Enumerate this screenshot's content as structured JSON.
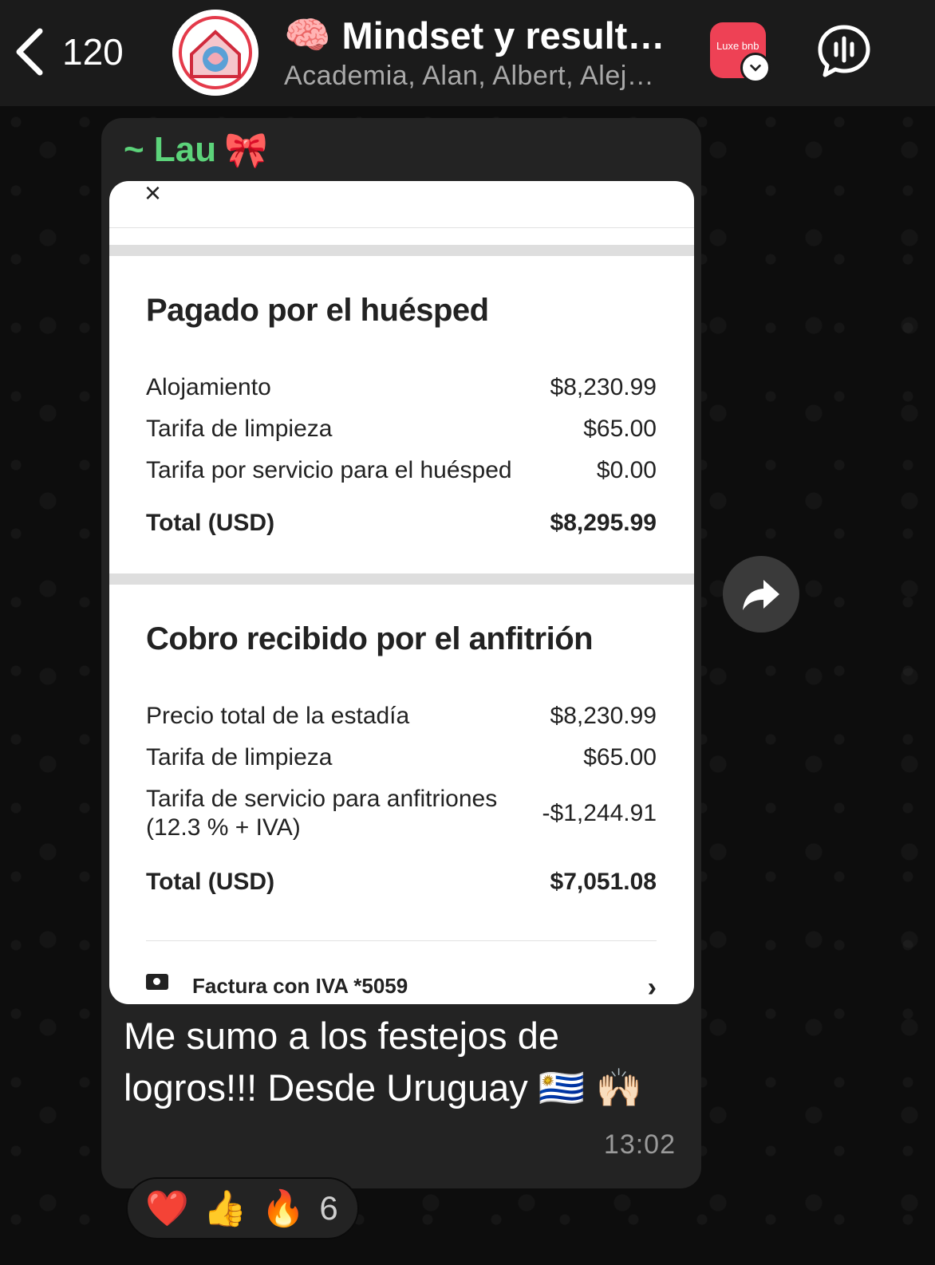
{
  "header": {
    "back_count": "120",
    "title_emoji": "🧠",
    "title": "Mindset y result…",
    "subtitle": "Academia, Alan, Albert, Alej…",
    "badge_text": "Luxe bnb"
  },
  "message": {
    "sender": "~ Lau",
    "sender_emoji": "🎀",
    "text": "Me sumo a los festejos de logros!!! Desde Uruguay 🇺🇾 🙌🏻",
    "time": "13:02"
  },
  "receipt": {
    "close_icon": "×",
    "guest_section": {
      "title": "Pagado por el huésped",
      "rows": [
        {
          "label": "Alojamiento",
          "value": "$8,230.99"
        },
        {
          "label": "Tarifa de limpieza",
          "value": "$65.00"
        },
        {
          "label": "Tarifa por servicio para el huésped",
          "value": "$0.00"
        }
      ],
      "total_label": "Total (USD)",
      "total_value": "$8,295.99"
    },
    "host_section": {
      "title": "Cobro recibido por el anfitrión",
      "rows": [
        {
          "label": "Precio total de la estadía",
          "value": "$8,230.99"
        },
        {
          "label": "Tarifa de limpieza",
          "value": "$65.00"
        },
        {
          "label": "Tarifa de servicio para anfitriones",
          "label2": "(12.3 % + IVA)",
          "value": "-$1,244.91"
        }
      ],
      "total_label": "Total (USD)",
      "total_value": "$7,051.08"
    },
    "invoice_label": "Factura con IVA *5059",
    "invoice_chevron": "›"
  },
  "reactions": {
    "emojis": [
      "❤️",
      "👍",
      "🔥"
    ],
    "count": "6"
  },
  "colors": {
    "sender_name": "#5cd37a",
    "bubble": "#232323",
    "header_bg": "#1b1b1b"
  }
}
